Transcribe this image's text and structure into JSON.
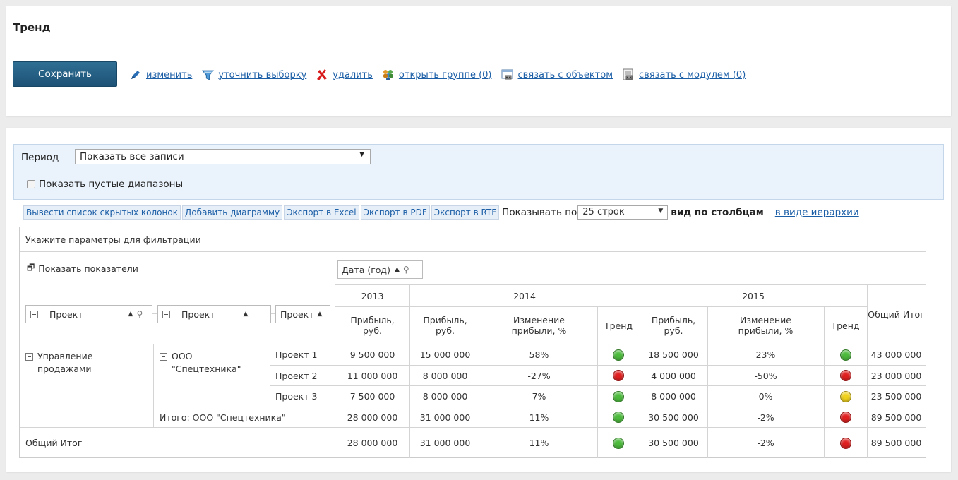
{
  "header": {
    "title": "Тренд"
  },
  "toolbar": {
    "save_label": "Сохранить",
    "links": [
      {
        "label": "изменить",
        "icon": "pencil-icon"
      },
      {
        "label": "уточнить выборку",
        "icon": "funnel-icon"
      },
      {
        "label": "удалить",
        "icon": "delete-x-icon"
      },
      {
        "label": "открыть группе (0)",
        "icon": "group-users-icon"
      },
      {
        "label": "связать с объектом",
        "icon": "link-object-icon"
      },
      {
        "label": "связать с модулем (0)",
        "icon": "link-module-icon"
      }
    ]
  },
  "filter": {
    "period_label": "Период",
    "period_value": "Показать все записи",
    "show_empty_label": "Показать пустые диапазоны"
  },
  "actions": {
    "hidden_cols": "Вывести список скрытых колонок",
    "add_chart": "Добавить диаграмму",
    "export_excel": "Экспорт в Excel",
    "export_pdf": "Экспорт в PDF",
    "export_rtf": "Экспорт в RTF",
    "show_by": "Показывать по",
    "rows_value": "25 строк",
    "view_columns": "вид по столбцам",
    "view_hierarchy": "в виде иерархии"
  },
  "pivot": {
    "filter_hint": "Укажите параметры для фильтрации",
    "show_measures": "Показать показатели",
    "date_field": "Дата (год)",
    "row_fields": [
      "Проект",
      "Проект",
      "Проект"
    ],
    "years": [
      "2013",
      "2014",
      "2015"
    ],
    "grand_total_header": "Общий Итог",
    "measures": {
      "profit": "Прибыль, руб.",
      "change": "Изменение прибыли, %",
      "trend": "Тренд"
    },
    "dims": {
      "lvl1": "Управление продажами",
      "lvl2": "ООО \"Спецтехника\"",
      "subtotal": "Итого: ООО \"Спецтехника\"",
      "grand": "Общий Итог"
    },
    "colors": {
      "green": "#4cbb3c",
      "red": "#e02020",
      "yellow": "#f0d21a"
    },
    "rows": [
      {
        "label": "Проект 1",
        "p2013": "9 500 000",
        "p2014": "15 000 000",
        "c2014": "58%",
        "t2014": "green",
        "p2015": "18 500 000",
        "c2015": "23%",
        "t2015": "green",
        "total": "43 000 000"
      },
      {
        "label": "Проект 2",
        "p2013": "11 000 000",
        "p2014": "8 000 000",
        "c2014": "-27%",
        "t2014": "red",
        "p2015": "4 000 000",
        "c2015": "-50%",
        "t2015": "red",
        "total": "23 000 000"
      },
      {
        "label": "Проект 3",
        "p2013": "7 500 000",
        "p2014": "8 000 000",
        "c2014": "7%",
        "t2014": "green",
        "p2015": "8 000 000",
        "c2015": "0%",
        "t2015": "yellow",
        "total": "23 500 000"
      },
      {
        "label": "",
        "p2013": "28 000 000",
        "p2014": "31 000 000",
        "c2014": "11%",
        "t2014": "green",
        "p2015": "30 500 000",
        "c2015": "-2%",
        "t2015": "red",
        "total": "89 500 000"
      },
      {
        "label": "",
        "p2013": "28 000 000",
        "p2014": "31 000 000",
        "c2014": "11%",
        "t2014": "green",
        "p2015": "30 500 000",
        "c2015": "-2%",
        "t2015": "red",
        "total": "89 500 000"
      }
    ]
  }
}
